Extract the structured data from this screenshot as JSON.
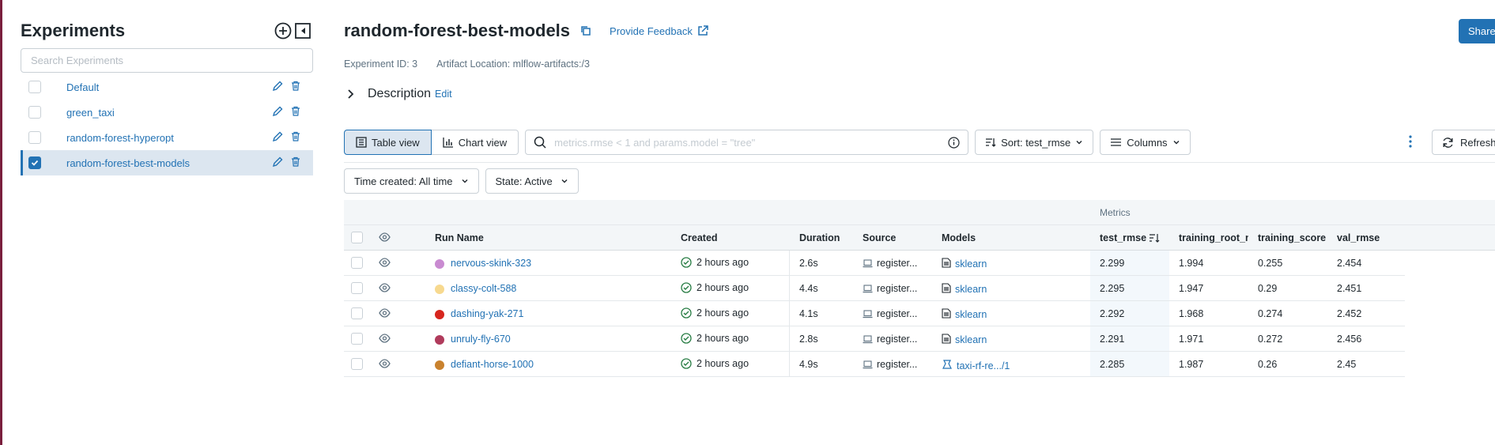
{
  "sidebar": {
    "title": "Experiments",
    "search_placeholder": "Search Experiments",
    "experiments": [
      {
        "name": "Default",
        "selected": false
      },
      {
        "name": "green_taxi",
        "selected": false
      },
      {
        "name": "random-forest-hyperopt",
        "selected": false
      },
      {
        "name": "random-forest-best-models",
        "selected": true
      }
    ]
  },
  "header": {
    "title": "random-forest-best-models",
    "feedback": "Provide Feedback",
    "share": "Share",
    "experiment_id": "Experiment ID: 3",
    "artifact_location": "Artifact Location: mlflow-artifacts:/3",
    "description": "Description",
    "description_edit": "Edit"
  },
  "toolbar": {
    "table_view": "Table view",
    "chart_view": "Chart view",
    "filter_placeholder": "metrics.rmse < 1 and params.model = \"tree\"",
    "sort": "Sort: test_rmse",
    "columns": "Columns",
    "refresh": "Refresh",
    "time_created": "Time created: All time",
    "state": "State: Active"
  },
  "table": {
    "group_label": "Metrics",
    "columns": [
      "Run Name",
      "Created",
      "Duration",
      "Source",
      "Models",
      "test_rmse",
      "training_root_n",
      "training_score",
      "val_rmse"
    ],
    "rows": [
      {
        "color": "#c98bd1",
        "name": "nervous-skink-323",
        "created": "2 hours ago",
        "duration": "2.6s",
        "source": "register...",
        "model": "sklearn",
        "model_type": "sklearn",
        "test_rmse": "2.299",
        "training_root": "1.994",
        "training_score": "0.255",
        "val_rmse": "2.454"
      },
      {
        "color": "#f7d98f",
        "name": "classy-colt-588",
        "created": "2 hours ago",
        "duration": "4.4s",
        "source": "register...",
        "model": "sklearn",
        "model_type": "sklearn",
        "test_rmse": "2.295",
        "training_root": "1.947",
        "training_score": "0.29",
        "val_rmse": "2.451"
      },
      {
        "color": "#d7261e",
        "name": "dashing-yak-271",
        "created": "2 hours ago",
        "duration": "4.1s",
        "source": "register...",
        "model": "sklearn",
        "model_type": "sklearn",
        "test_rmse": "2.292",
        "training_root": "1.968",
        "training_score": "0.274",
        "val_rmse": "2.452"
      },
      {
        "color": "#b03b5c",
        "name": "unruly-fly-670",
        "created": "2 hours ago",
        "duration": "2.8s",
        "source": "register...",
        "model": "sklearn",
        "model_type": "sklearn",
        "test_rmse": "2.291",
        "training_root": "1.971",
        "training_score": "0.272",
        "val_rmse": "2.456"
      },
      {
        "color": "#c9822e",
        "name": "defiant-horse-1000",
        "created": "2 hours ago",
        "duration": "4.9s",
        "source": "register...",
        "model": "taxi-rf-re.../1",
        "model_type": "registered",
        "test_rmse": "2.285",
        "training_root": "1.987",
        "training_score": "0.26",
        "val_rmse": "2.45"
      }
    ]
  },
  "colors": {
    "accent": "#2272b4",
    "success": "#277c43"
  }
}
